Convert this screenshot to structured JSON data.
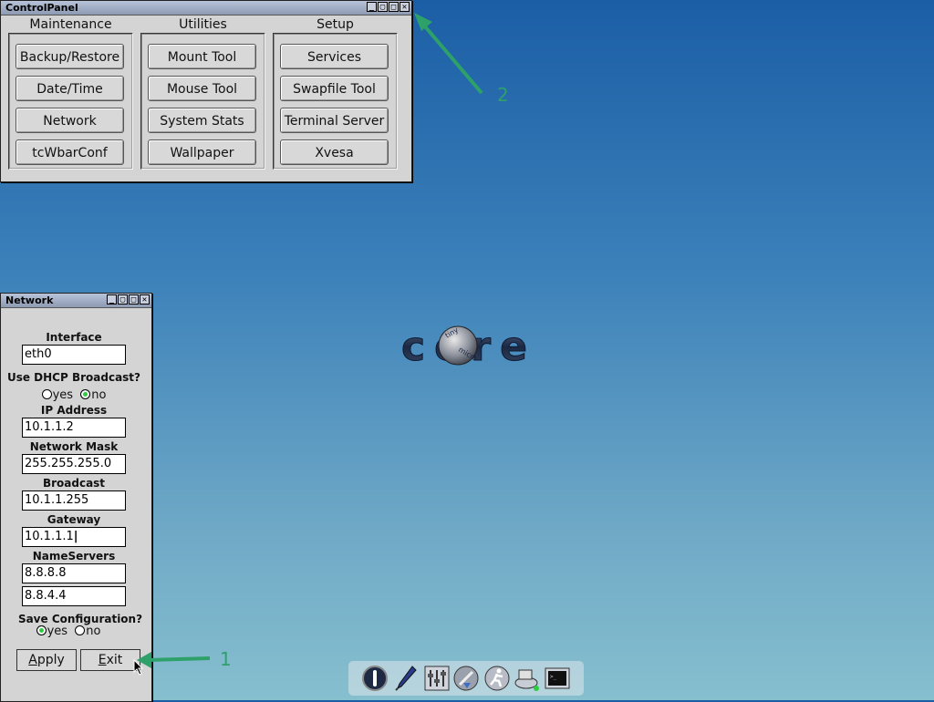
{
  "control_panel": {
    "title": "ControlPanel",
    "columns": [
      {
        "heading": "Maintenance",
        "buttons": [
          "Backup/Restore",
          "Date/Time",
          "Network",
          "tcWbarConf"
        ]
      },
      {
        "heading": "Utilities",
        "buttons": [
          "Mount Tool",
          "Mouse Tool",
          "System Stats",
          "Wallpaper"
        ]
      },
      {
        "heading": "Setup",
        "buttons": [
          "Services",
          "Swapfile Tool",
          "Terminal Server",
          "Xvesa"
        ]
      }
    ]
  },
  "network": {
    "title": "Network",
    "interface_label": "Interface",
    "interface_value": "eth0",
    "dhcp_label": "Use DHCP Broadcast?",
    "dhcp_yes": "yes",
    "dhcp_no": "no",
    "dhcp_selected": "no",
    "ip_label": "IP Address",
    "ip_value": "10.1.1.2",
    "mask_label": "Network Mask",
    "mask_value": "255.255.255.0",
    "broadcast_label": "Broadcast",
    "broadcast_value": "10.1.1.255",
    "gateway_label": "Gateway",
    "gateway_value": "10.1.1.1",
    "nameservers_label": "NameServers",
    "nameserver1": "8.8.8.8",
    "nameserver2": "8.8.4.4",
    "save_label": "Save Configuration?",
    "save_yes": "yes",
    "save_no": "no",
    "save_selected": "yes",
    "apply_label": "Apply",
    "exit_label": "Exit"
  },
  "desktop": {
    "logo_text": "core",
    "logo_small1": "tiny",
    "logo_small2": "micro"
  },
  "annotations": {
    "marker1": "1",
    "marker2": "2"
  },
  "taskbar": {
    "icons": [
      "power-icon",
      "editor-pen-icon",
      "control-panel-icon",
      "apps-download-icon",
      "run-icon",
      "mount-drive-icon",
      "terminal-icon"
    ]
  },
  "colors": {
    "accent_green": "#2ea06a",
    "titlebar": "#a3aec4"
  }
}
